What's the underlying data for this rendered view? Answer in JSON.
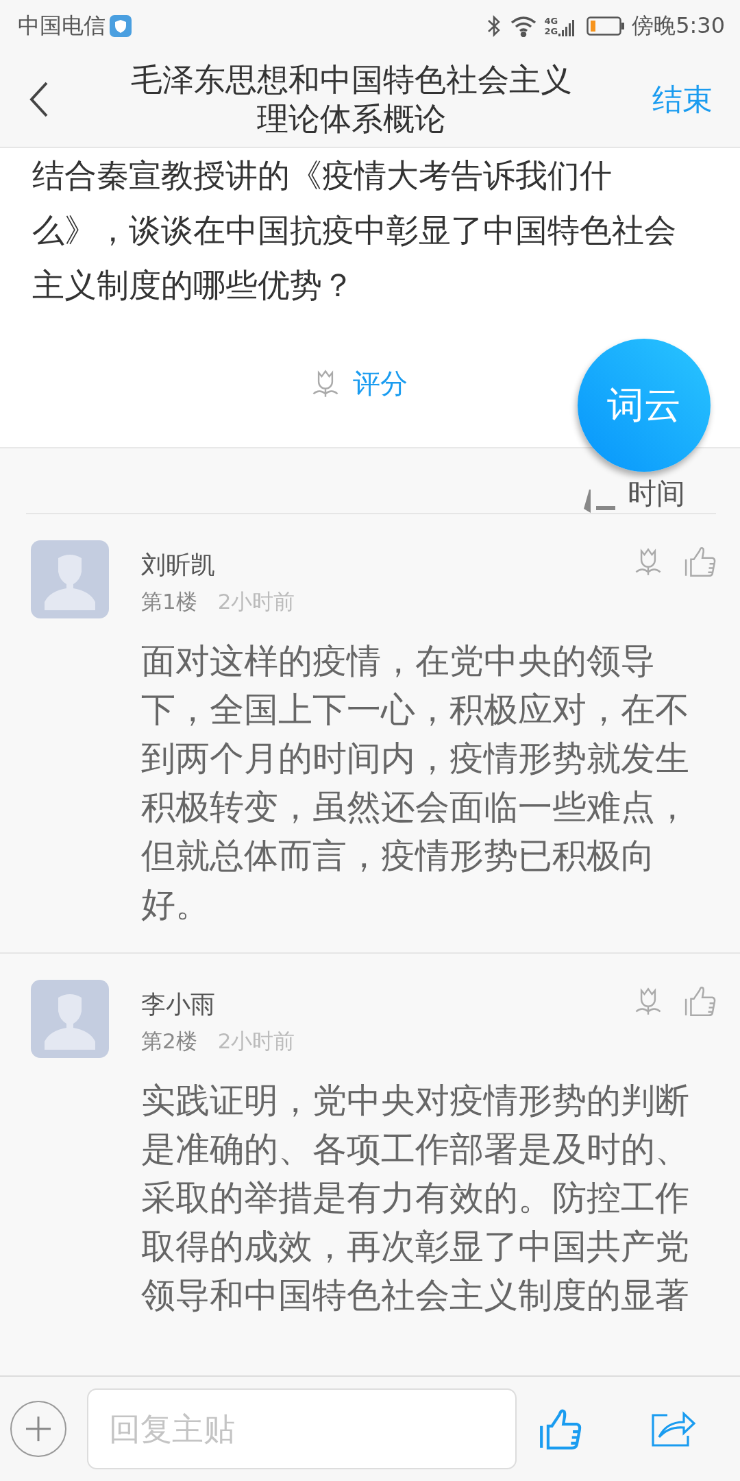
{
  "status_bar": {
    "carrier": "中国电信",
    "network": [
      "4G",
      "2G"
    ],
    "time": "傍晚5:30"
  },
  "header": {
    "title": "毛泽东思想和中国特色社会主义理论体系概论",
    "action": "结束"
  },
  "question": {
    "text": "结合秦宣教授讲的《疫情大考告诉我们什么》，谈谈在中国抗疫中彰显了中国特色社会主义制度的哪些优势？",
    "rate_label": "评分"
  },
  "word_cloud_button": "词云",
  "sort": {
    "label": "时间"
  },
  "replies": [
    {
      "name": "刘昕凯",
      "floor": "第1楼",
      "time": "2小时前",
      "text": "面对这样的疫情，在党中央的领导下，全国上下一心，积极应对，在不到两个月的时间内，疫情形势就发生积极转变，虽然还会面临一些难点，但就总体而言，疫情形势已积极向好。"
    },
    {
      "name": "李小雨",
      "floor": "第2楼",
      "time": "2小时前",
      "text": "实践证明，党中央对疫情形势的判断是准确的、各项工作部署是及时的、采取的举措是有力有效的。防控工作取得的成效，再次彰显了中国共产党领导和中国特色社会主义制度的显著"
    }
  ],
  "composer": {
    "placeholder": "回复主贴"
  }
}
